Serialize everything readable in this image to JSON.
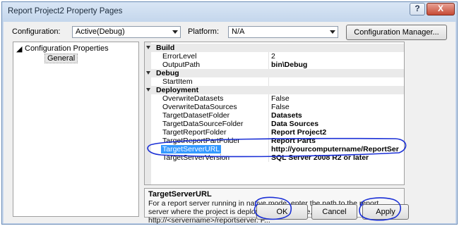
{
  "window": {
    "title": "Report Project2 Property Pages",
    "help_glyph": "?",
    "close_glyph": "X"
  },
  "header": {
    "configuration_label": "Configuration:",
    "configuration_value": "Active(Debug)",
    "platform_label": "Platform:",
    "platform_value": "N/A",
    "config_manager_label": "Configuration Manager..."
  },
  "tree": {
    "root": "Configuration Properties",
    "child": "General"
  },
  "grid": {
    "categories": {
      "build": "Build",
      "debug": "Debug",
      "deployment": "Deployment"
    },
    "rows": {
      "error_level": {
        "name": "ErrorLevel",
        "value": "2"
      },
      "output_path": {
        "name": "OutputPath",
        "value": "bin\\Debug"
      },
      "start_item": {
        "name": "StartItem",
        "value": ""
      },
      "overwrite_datasets": {
        "name": "OverwriteDatasets",
        "value": "False"
      },
      "overwrite_datasources": {
        "name": "OverwriteDataSources",
        "value": "False"
      },
      "target_dataset_folder": {
        "name": "TargetDatasetFolder",
        "value": "Datasets"
      },
      "target_datasource_folder": {
        "name": "TargetDataSourceFolder",
        "value": "Data Sources"
      },
      "target_report_folder": {
        "name": "TargetReportFolder",
        "value": "Report Project2"
      },
      "target_reportpart_folder": {
        "name": "TargetReportPartFolder",
        "value": "Report Parts"
      },
      "target_server_url": {
        "name": "TargetServerURL",
        "value": "http://yourcomputername/ReportSer"
      },
      "target_server_version": {
        "name": "TargetServerVersion",
        "value": "SQL Server 2008 R2 or later"
      }
    }
  },
  "description": {
    "title": "TargetServerURL",
    "text": "For a report server running in native mode, enter the path to the report server where the project is deployed, for example, http://<servername>/reportserver. F..."
  },
  "buttons": {
    "ok": "OK",
    "cancel": "Cancel",
    "apply": "Apply"
  },
  "colors": {
    "selection": "#3399ff",
    "annotation_ink": "#1a2fd6",
    "title_bar": "#c9d9ee"
  }
}
